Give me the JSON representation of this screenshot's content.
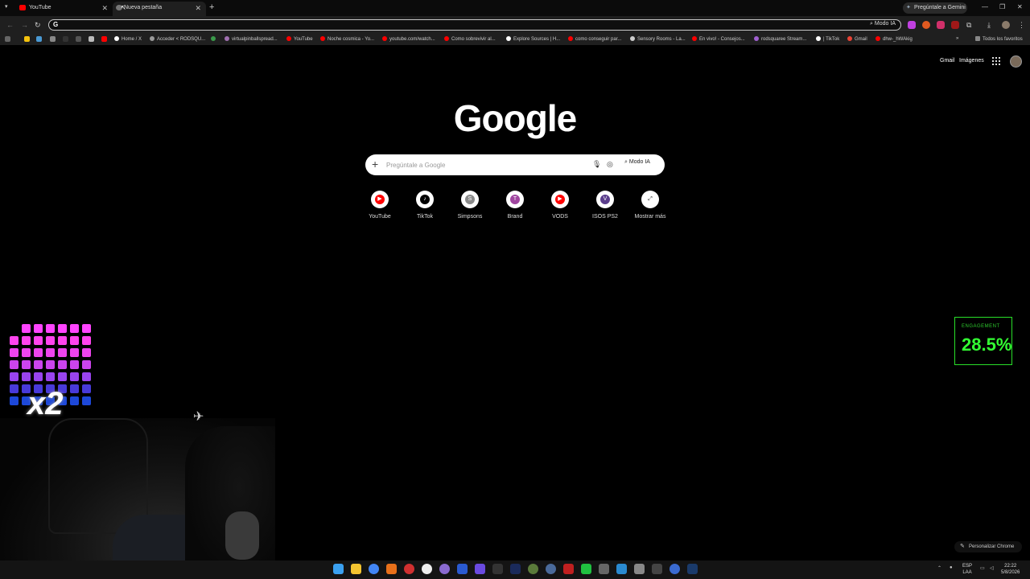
{
  "browser": {
    "tabs": [
      {
        "title": "YouTube",
        "color": "#ff0000"
      },
      {
        "title": "Nueva pestaña",
        "color": "#888888"
      }
    ],
    "gemini_label": "Pregúntale a Gemini",
    "omnibox_ai_label": "Modo IA"
  },
  "bookmarks": [
    "Home / X",
    "Acceder < RODSQU...",
    "virtualpinballspread...",
    "YouTube",
    "Noche cosmica - Yo...",
    "youtube.com/watch...",
    "Como sobrevivir al...",
    "Explore Sources | H...",
    "como conseguir par...",
    "Sensory Rooms - La...",
    "En vivo! - Consejos...",
    "rodsquaree Stream...",
    "| TikTok",
    "Gmail",
    "dhw-_hWAkig"
  ],
  "all_bookmarks": "Todos los favoritos",
  "google": {
    "gmail": "Gmail",
    "images": "Imágenes",
    "logo": "Google",
    "search_placeholder": "Pregúntale a Google",
    "ai_mode": "Modo IA",
    "shortcuts": [
      {
        "label": "YouTube",
        "letter": "",
        "color": "#ff0000"
      },
      {
        "label": "TikTok",
        "letter": "",
        "color": "#000000"
      },
      {
        "label": "Simpsons",
        "letter": "S",
        "color": "#8a8a8a"
      },
      {
        "label": "Brand",
        "letter": "T",
        "color": "#a046a0"
      },
      {
        "label": "VODS",
        "letter": "",
        "color": "#ff0000"
      },
      {
        "label": "ISOS PS2",
        "letter": "V",
        "color": "#5b3e8c"
      },
      {
        "label": "Mostrar más",
        "letter": "",
        "color": "#ffffff"
      }
    ],
    "customize": "Personalizar Chrome"
  },
  "overlay": {
    "engagement_title": "ENGAGEMENT",
    "engagement_value": "28.5%",
    "multiplier": "x2"
  },
  "taskbar": {
    "lang_line1": "ESP",
    "lang_line2": "LAA",
    "time": "22:22",
    "date": "5/8/2026"
  }
}
